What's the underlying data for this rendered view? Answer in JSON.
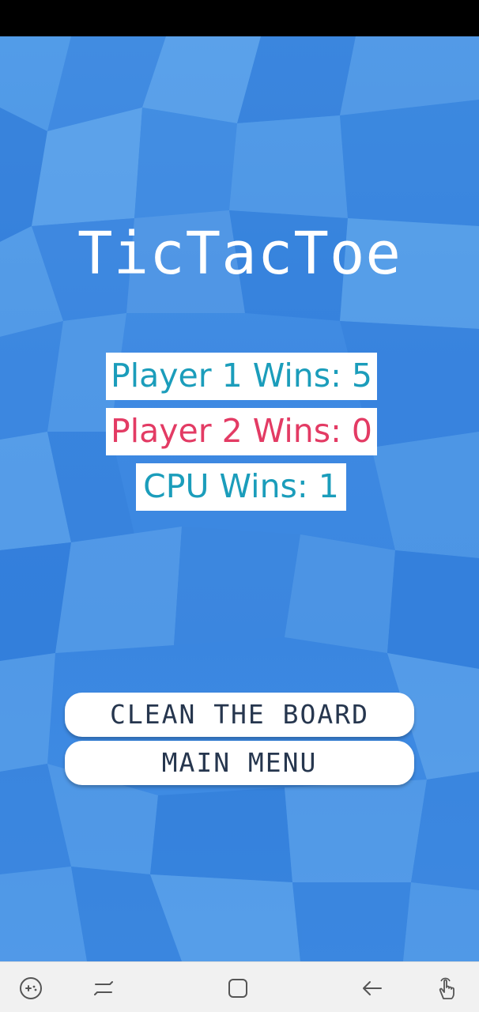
{
  "app": {
    "title": "TicTacToe"
  },
  "scores": {
    "player1": "Player 1 Wins: 5",
    "player2": "Player 2 Wins: 0",
    "cpu": "CPU Wins: 1"
  },
  "buttons": {
    "clean_board": "CLEAN THE BOARD",
    "main_menu": "MAIN MENU"
  },
  "colors": {
    "background": "#3f8ee6",
    "player1_text": "#1b9dbb",
    "player2_text": "#e33b64",
    "cpu_text": "#1b9dbb",
    "button_text": "#26364e"
  },
  "nav_bar": {
    "icons": [
      "game-tools-icon",
      "recents-icon",
      "home-icon",
      "back-icon",
      "gesture-icon"
    ]
  }
}
